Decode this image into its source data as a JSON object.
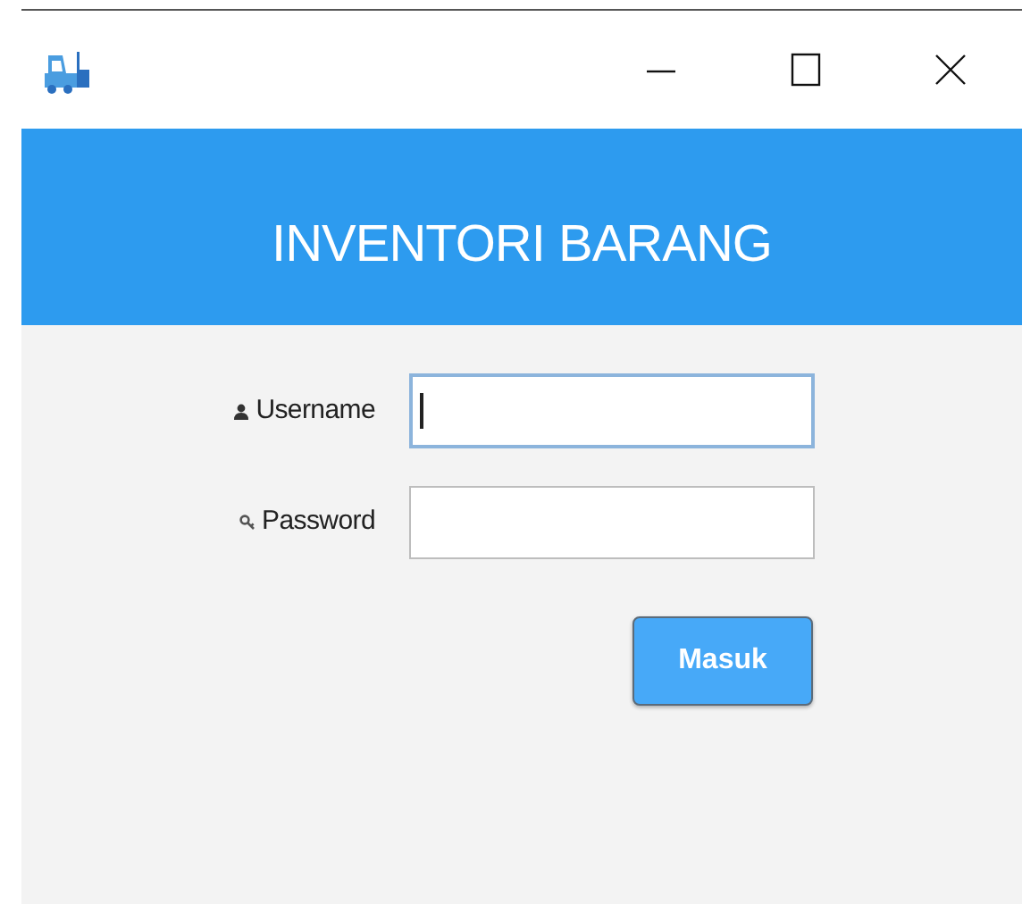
{
  "window": {
    "controls": [
      {
        "kind": "minimize"
      },
      {
        "kind": "maximize"
      },
      {
        "kind": "close"
      }
    ]
  },
  "header": {
    "title": "INVENTORI BARANG"
  },
  "form": {
    "fields": [
      {
        "kind": "user",
        "label": "Username",
        "focused": true
      },
      {
        "kind": "key",
        "label": "Password",
        "focused": false
      }
    ],
    "button": "Masuk"
  }
}
